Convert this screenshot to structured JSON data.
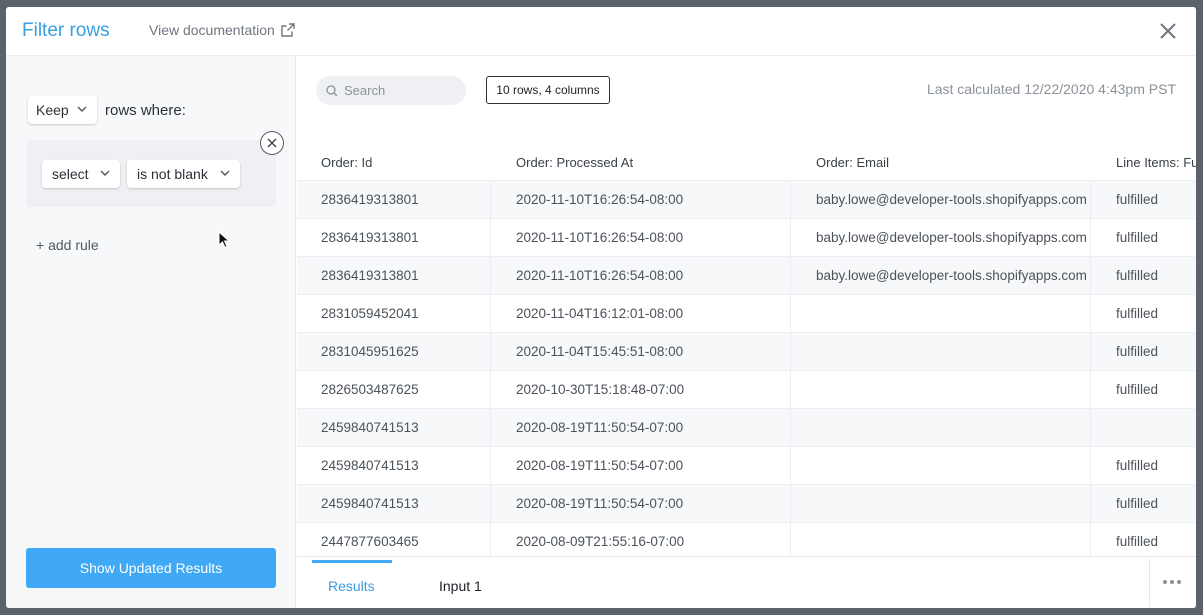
{
  "header": {
    "title": "Filter rows",
    "doc_link": "View documentation"
  },
  "filter": {
    "keep_value": "Keep",
    "rows_where": "rows where:",
    "rule": {
      "column": "select",
      "condition": "is not blank"
    },
    "add_rule": "+ add rule",
    "show_button": "Show Updated Results"
  },
  "results": {
    "search_placeholder": "Search",
    "row_count": "10 rows, 4 columns",
    "last_calculated": "Last calculated 12/22/2020 4:43pm PST",
    "columns": [
      "Order: Id",
      "Order: Processed At",
      "Order: Email",
      "Line Items: Fu"
    ],
    "rows": [
      [
        "2836419313801",
        "2020-11-10T16:26:54-08:00",
        "baby.lowe@developer-tools.shopifyapps.com",
        "fulfilled"
      ],
      [
        "2836419313801",
        "2020-11-10T16:26:54-08:00",
        "baby.lowe@developer-tools.shopifyapps.com",
        "fulfilled"
      ],
      [
        "2836419313801",
        "2020-11-10T16:26:54-08:00",
        "baby.lowe@developer-tools.shopifyapps.com",
        "fulfilled"
      ],
      [
        "2831059452041",
        "2020-11-04T16:12:01-08:00",
        "",
        "fulfilled"
      ],
      [
        "2831045951625",
        "2020-11-04T15:45:51-08:00",
        "",
        "fulfilled"
      ],
      [
        "2826503487625",
        "2020-10-30T15:18:48-07:00",
        "",
        "fulfilled"
      ],
      [
        "2459840741513",
        "2020-08-19T11:50:54-07:00",
        "",
        ""
      ],
      [
        "2459840741513",
        "2020-08-19T11:50:54-07:00",
        "",
        "fulfilled"
      ],
      [
        "2459840741513",
        "2020-08-19T11:50:54-07:00",
        "",
        "fulfilled"
      ],
      [
        "2447877603465",
        "2020-08-09T21:55:16-07:00",
        "",
        "fulfilled"
      ]
    ]
  },
  "tabs": {
    "results": "Results",
    "input": "Input 1"
  },
  "colors": {
    "accent": "#3fa9f5",
    "title": "#3a9fe0"
  },
  "icons": [
    "external-link-icon",
    "close-icon",
    "chevron-down-icon",
    "search-icon",
    "remove-rule-icon",
    "cursor-icon",
    "more-icon"
  ]
}
